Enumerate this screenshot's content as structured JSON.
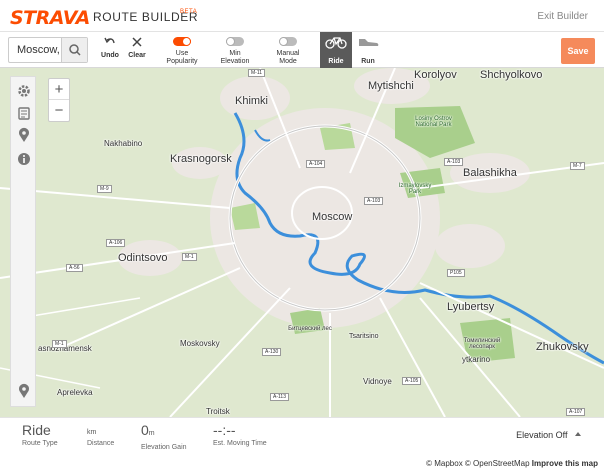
{
  "header": {
    "logo": "STRAVA",
    "title": "ROUTE BUILDER",
    "beta": "BETA",
    "exit_label": "Exit Builder"
  },
  "toolbar": {
    "search_value": "Moscow,",
    "undo_label": "Undo",
    "clear_label": "Clear",
    "popularity_label": "Use Popularity",
    "popularity_on": true,
    "min_elevation_label": "Min Elevation",
    "min_elevation_on": false,
    "manual_mode_label": "Manual Mode",
    "manual_mode_on": false,
    "ride_label": "Ride",
    "run_label": "Run",
    "save_label": "Save",
    "accent": "#fc4c02"
  },
  "map": {
    "places": {
      "korolyov": "Korolyov",
      "shchyolkovo": "Shchyolkovo",
      "mytishchi": "Mytishchi",
      "khimki": "Khimki",
      "losiny": "Losiny Ostrov National Park",
      "nakhabino": "Nakhabino",
      "krasnogorsk": "Krasnogorsk",
      "balashikha": "Balashikha",
      "izmaylovsky": "Izmaylovsky Park",
      "moscow": "Moscow",
      "odintsovo": "Odintsovo",
      "lyubertsy": "Lyubertsy",
      "bitsevsky": "Битцевский лес",
      "tsaritsino": "Tsaritsino",
      "tomilinsky": "Томилинский лесопарк",
      "zhukovsky": "Zhukovsky",
      "moskovsky": "Moskovsky",
      "vnukovo": "asnoznamensk",
      "aprelevka": "Aprelevka",
      "troitsk": "Troitsk",
      "vidnoye": "Vidnoye",
      "tkarino": "ytkarino"
    },
    "roads": {
      "m11": "M-11",
      "a104": "A-104",
      "a103a": "A-103",
      "a103b": "A-103",
      "m7": "M-7",
      "m9": "M-9",
      "a106": "A-106",
      "m1": "M-1",
      "a56": "A-56",
      "p105": "P105",
      "m1b": "M-1",
      "a130": "A-130",
      "a105": "A-105",
      "a113": "A-113",
      "a107": "A-107"
    }
  },
  "footer": {
    "route_type_value": "Ride",
    "route_type_label": "Route Type",
    "distance_unit": "km",
    "distance_label": "Distance",
    "elevation_value": "0",
    "elevation_unit": "m",
    "elevation_label": "Elevation Gain",
    "moving_time_value": "--:--",
    "moving_time_label": "Est. Moving Time",
    "elevation_toggle": "Elevation Off"
  },
  "attribution": {
    "mapbox": "© Mapbox",
    "osm": "© OpenStreetMap",
    "improve": "Improve this map"
  }
}
